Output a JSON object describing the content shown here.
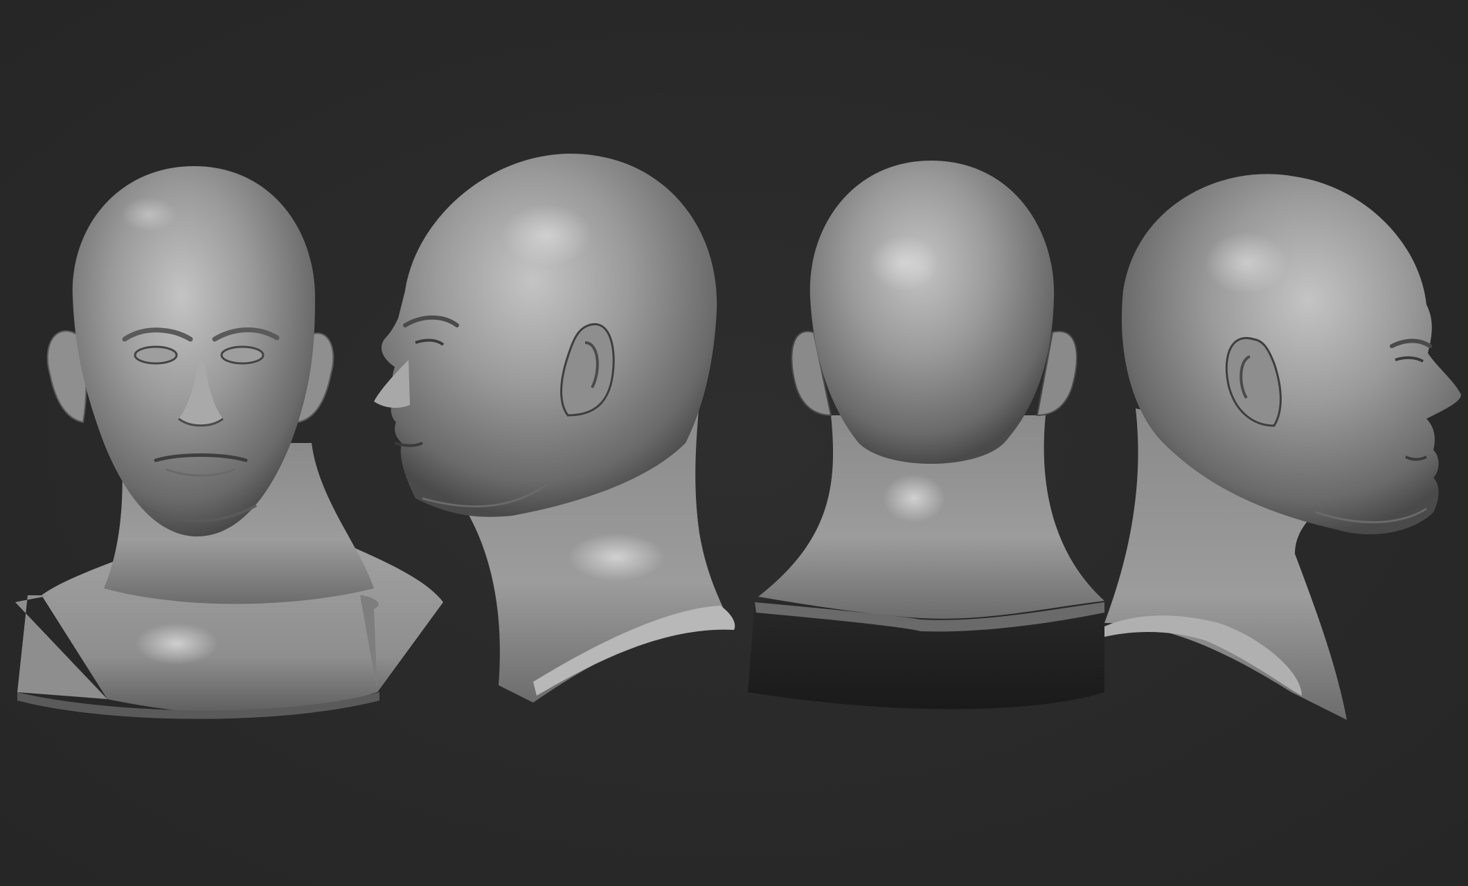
{
  "scene": {
    "views": [
      {
        "id": "front",
        "view_name": "front-view"
      },
      {
        "id": "left",
        "view_name": "left-profile-view"
      },
      {
        "id": "back",
        "view_name": "back-view"
      },
      {
        "id": "right",
        "view_name": "right-profile-view"
      }
    ],
    "colors": {
      "background": "#2a2a2a",
      "clay_light": "#bdbdbd",
      "clay_mid": "#8f8f8f",
      "clay_dark": "#3e3e3e",
      "rim": "#1c1c1c"
    }
  }
}
